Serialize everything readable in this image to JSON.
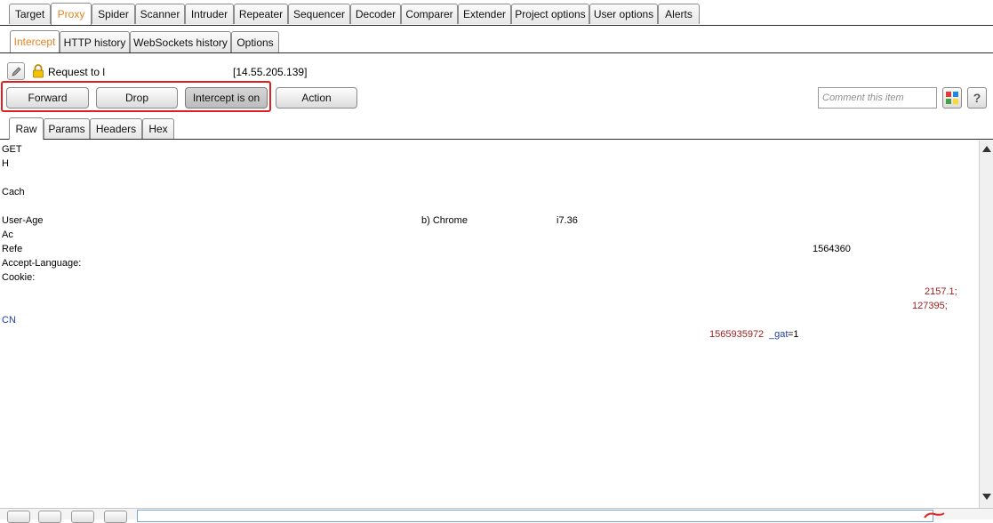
{
  "main_tabs": [
    {
      "label": "Target",
      "active": false
    },
    {
      "label": "Proxy",
      "active": true
    },
    {
      "label": "Spider",
      "active": false
    },
    {
      "label": "Scanner",
      "active": false
    },
    {
      "label": "Intruder",
      "active": false
    },
    {
      "label": "Repeater",
      "active": false
    },
    {
      "label": "Sequencer",
      "active": false
    },
    {
      "label": "Decoder",
      "active": false
    },
    {
      "label": "Comparer",
      "active": false
    },
    {
      "label": "Extender",
      "active": false
    },
    {
      "label": "Project options",
      "active": false
    },
    {
      "label": "User options",
      "active": false
    },
    {
      "label": "Alerts",
      "active": false
    }
  ],
  "proxy_tabs": [
    {
      "label": "Intercept",
      "active": true
    },
    {
      "label": "HTTP history",
      "active": false
    },
    {
      "label": "WebSockets history",
      "active": false
    },
    {
      "label": "Options",
      "active": false
    }
  ],
  "request": {
    "prefix": "Request to l",
    "ip": "[14.55.205.139]"
  },
  "buttons": {
    "forward": "Forward",
    "drop": "Drop",
    "intercept": "Intercept is on",
    "action": "Action"
  },
  "comment": {
    "placeholder": "Comment this item"
  },
  "help_label": "?",
  "message_tabs": [
    {
      "label": "Raw",
      "active": true
    },
    {
      "label": "Params",
      "active": false
    },
    {
      "label": "Headers",
      "active": false
    },
    {
      "label": "Hex",
      "active": false
    }
  ],
  "request_lines": [
    {
      "text": "GET",
      "color": "#000000"
    },
    {
      "text": "H",
      "color": "#000000"
    },
    {
      "text": "Cach",
      "color": "#000000"
    },
    {
      "text": "User-Age",
      "color": "#000000"
    },
    {
      "text": "Ac",
      "color": "#000000"
    },
    {
      "text": "Refe",
      "color": "#000000"
    },
    {
      "text": "Accept-Language:",
      "color": "#000000"
    },
    {
      "text": "Cookie:",
      "color": "#000000"
    },
    {
      "text": "CN",
      "color": "#1f3faa"
    }
  ],
  "request_fragments": {
    "chrome": "b) Chrome",
    "version_tail": "i7.36",
    "referer_tail": "1564360",
    "cookie_tail_1": "2157.1;",
    "cookie_tail_2": "127395;",
    "timestamp": "1565935972",
    "gat_name": "_gat",
    "gat_value": "=1"
  },
  "colors": {
    "accent_tab": "#e8821e",
    "highlight_border": "#e02020",
    "cookie_name": "#1f3faa",
    "cookie_value": "#9b1c1c"
  }
}
